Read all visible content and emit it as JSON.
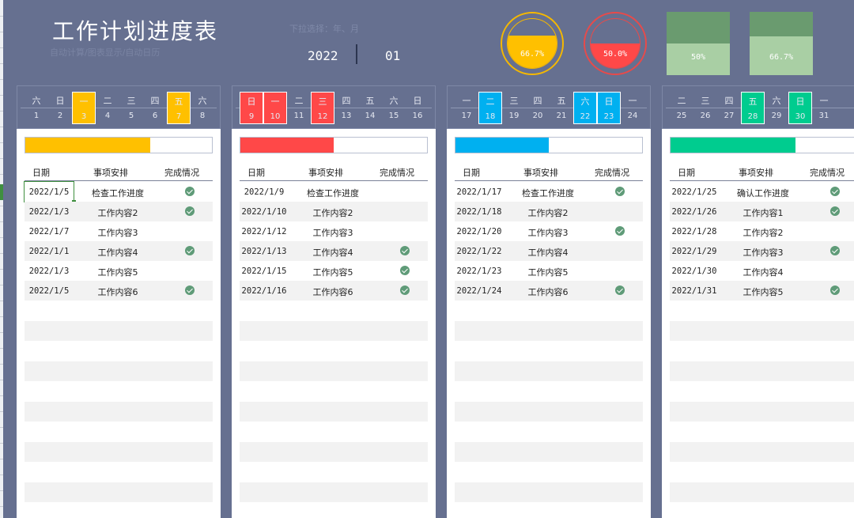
{
  "header": {
    "title": "工作计划进度表",
    "subtitle": "自动计算/图表显示/自动日历",
    "dropdown_hint": "下拉选择：年、月",
    "year": "2022",
    "month": "01"
  },
  "stats": {
    "gauge1": {
      "label": "66.7%",
      "fill_percent": 66.7,
      "color": "#ffc000"
    },
    "gauge2": {
      "label": "50.0%",
      "fill_percent": 50.0,
      "color": "#ff4848"
    },
    "square1": {
      "label": "50%",
      "fill_percent": 50,
      "color": "#6a9b6f"
    },
    "square2": {
      "label": "66.7%",
      "fill_percent": 66.7,
      "color": "#6a9b6f"
    }
  },
  "table_headers": {
    "date": "日期",
    "item": "事项安排",
    "done": "完成情况"
  },
  "cards": [
    {
      "accent": "#ffc000",
      "progress_percent": 67,
      "calendar": [
        {
          "wd": "六",
          "d": "1",
          "hl": false
        },
        {
          "wd": "日",
          "d": "2",
          "hl": false
        },
        {
          "wd": "一",
          "d": "3",
          "hl": true
        },
        {
          "wd": "二",
          "d": "4",
          "hl": false
        },
        {
          "wd": "三",
          "d": "5",
          "hl": false
        },
        {
          "wd": "四",
          "d": "6",
          "hl": false
        },
        {
          "wd": "五",
          "d": "7",
          "hl": true
        },
        {
          "wd": "六",
          "d": "8",
          "hl": false
        }
      ],
      "rows": [
        {
          "date": "2022/1/5",
          "item": "检查工作进度",
          "done": true,
          "selected": true
        },
        {
          "date": "2022/1/3",
          "item": "工作内容2",
          "done": true
        },
        {
          "date": "2022/1/7",
          "item": "工作内容3",
          "done": false
        },
        {
          "date": "2022/1/1",
          "item": "工作内容4",
          "done": true
        },
        {
          "date": "2022/1/3",
          "item": "工作内容5",
          "done": false
        },
        {
          "date": "2022/1/5",
          "item": "工作内容6",
          "done": true
        }
      ]
    },
    {
      "accent": "#ff4848",
      "progress_percent": 50,
      "calendar": [
        {
          "wd": "日",
          "d": "9",
          "hl": true
        },
        {
          "wd": "一",
          "d": "10",
          "hl": true
        },
        {
          "wd": "二",
          "d": "11",
          "hl": false
        },
        {
          "wd": "三",
          "d": "12",
          "hl": true
        },
        {
          "wd": "四",
          "d": "13",
          "hl": false
        },
        {
          "wd": "五",
          "d": "14",
          "hl": false
        },
        {
          "wd": "六",
          "d": "15",
          "hl": false
        },
        {
          "wd": "日",
          "d": "16",
          "hl": false
        }
      ],
      "rows": [
        {
          "date": "2022/1/9",
          "item": "检查工作进度",
          "done": false
        },
        {
          "date": "2022/1/10",
          "item": "工作内容2",
          "done": false
        },
        {
          "date": "2022/1/12",
          "item": "工作内容3",
          "done": false
        },
        {
          "date": "2022/1/13",
          "item": "工作内容4",
          "done": true
        },
        {
          "date": "2022/1/15",
          "item": "工作内容5",
          "done": true
        },
        {
          "date": "2022/1/16",
          "item": "工作内容6",
          "done": true
        }
      ]
    },
    {
      "accent": "#00b0f0",
      "progress_percent": 50,
      "calendar": [
        {
          "wd": "一",
          "d": "17",
          "hl": false
        },
        {
          "wd": "二",
          "d": "18",
          "hl": true
        },
        {
          "wd": "三",
          "d": "19",
          "hl": false
        },
        {
          "wd": "四",
          "d": "20",
          "hl": false
        },
        {
          "wd": "五",
          "d": "21",
          "hl": false
        },
        {
          "wd": "六",
          "d": "22",
          "hl": true
        },
        {
          "wd": "日",
          "d": "23",
          "hl": true
        },
        {
          "wd": "一",
          "d": "24",
          "hl": false
        }
      ],
      "rows": [
        {
          "date": "2022/1/17",
          "item": "检查工作进度",
          "done": true
        },
        {
          "date": "2022/1/18",
          "item": "工作内容2",
          "done": false
        },
        {
          "date": "2022/1/20",
          "item": "工作内容3",
          "done": true
        },
        {
          "date": "2022/1/22",
          "item": "工作内容4",
          "done": false
        },
        {
          "date": "2022/1/23",
          "item": "工作内容5",
          "done": false
        },
        {
          "date": "2022/1/24",
          "item": "工作内容6",
          "done": true
        }
      ]
    },
    {
      "accent": "#00cc8f",
      "progress_percent": 67,
      "calendar": [
        {
          "wd": "二",
          "d": "25",
          "hl": false
        },
        {
          "wd": "三",
          "d": "26",
          "hl": false
        },
        {
          "wd": "四",
          "d": "27",
          "hl": false
        },
        {
          "wd": "五",
          "d": "28",
          "hl": true
        },
        {
          "wd": "六",
          "d": "29",
          "hl": false
        },
        {
          "wd": "日",
          "d": "30",
          "hl": true
        },
        {
          "wd": "一",
          "d": "31",
          "hl": false
        }
      ],
      "rows": [
        {
          "date": "2022/1/25",
          "item": "确认工作进度",
          "done": true
        },
        {
          "date": "2022/1/26",
          "item": "工作内容1",
          "done": true
        },
        {
          "date": "2022/1/28",
          "item": "工作内容2",
          "done": false
        },
        {
          "date": "2022/1/29",
          "item": "工作内容3",
          "done": true
        },
        {
          "date": "2022/1/30",
          "item": "工作内容4",
          "done": false
        },
        {
          "date": "2022/1/31",
          "item": "工作内容5",
          "done": true
        }
      ]
    }
  ]
}
